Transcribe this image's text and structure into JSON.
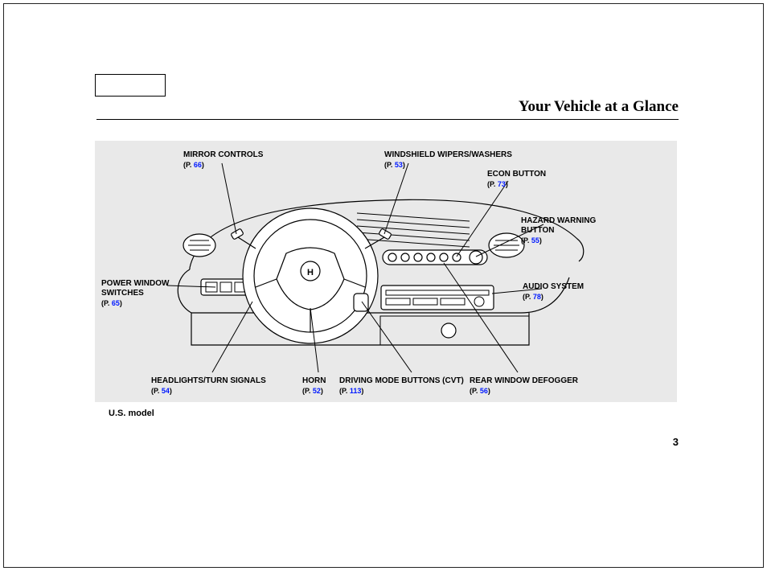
{
  "page": {
    "title": "Your Vehicle at a Glance",
    "caption": "U.S. model",
    "number": "3"
  },
  "callouts": {
    "mirror": {
      "label": "MIRROR CONTROLS",
      "p": "P.",
      "page": "66"
    },
    "wipers": {
      "label": "WINDSHIELD WIPERS/WASHERS",
      "p": "P.",
      "page": "53"
    },
    "econ": {
      "label": "ECON BUTTON",
      "p": "P.",
      "page": "73"
    },
    "hazard": {
      "label": "HAZARD WARNING\nBUTTON",
      "p": "P.",
      "page": "55"
    },
    "audio": {
      "label": "AUDIO SYSTEM",
      "p": "P.",
      "page": "78"
    },
    "defogger": {
      "label": "REAR WINDOW DEFOGGER",
      "p": "P.",
      "page": "56"
    },
    "driving": {
      "label": "DRIVING MODE BUTTONS (CVT)",
      "p": "P.",
      "page": "113"
    },
    "horn": {
      "label": "HORN",
      "p": "P.",
      "page": "52"
    },
    "headlights": {
      "label": "HEADLIGHTS/TURN SIGNALS",
      "p": "P.",
      "page": "54"
    },
    "power": {
      "label": "POWER WINDOW\nSWITCHES",
      "p": "P.",
      "page": "65"
    }
  }
}
